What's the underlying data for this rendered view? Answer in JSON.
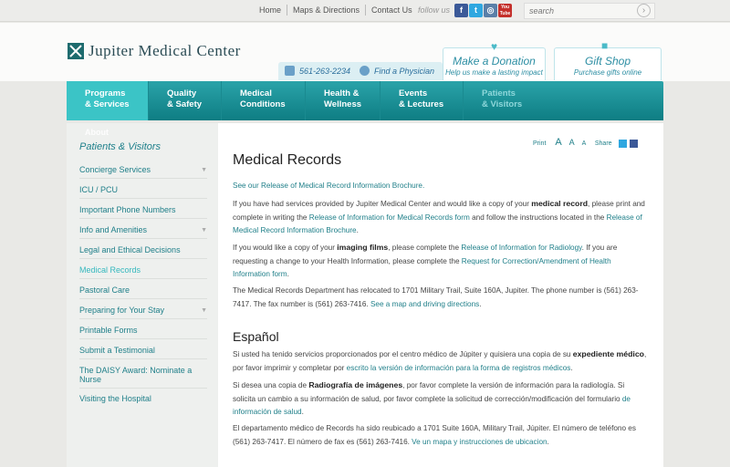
{
  "topbar": {
    "links": [
      "Home",
      "Maps & Directions",
      "Contact Us"
    ],
    "follow_label": "follow us",
    "social": [
      {
        "name": "facebook-icon",
        "glyph": "f",
        "color": "#3b5998"
      },
      {
        "name": "twitter-icon",
        "glyph": "t",
        "color": "#2fa7e0"
      },
      {
        "name": "instagram-icon",
        "glyph": "◎",
        "color": "#5a7fa8"
      },
      {
        "name": "youtube-icon",
        "glyph": "You Tube",
        "color": "#c4302b"
      }
    ],
    "search_placeholder": "search"
  },
  "brand": {
    "name": "Jupiter Medical Center",
    "accent": "#138a91"
  },
  "contact": {
    "phone": "561-263-2234",
    "find_physician": "Find a Physician"
  },
  "promos": [
    {
      "title": "Make a Donation",
      "subtitle": "Help us make a lasting impact"
    },
    {
      "title": "Gift Shop",
      "subtitle": "Purchase gifts online"
    }
  ],
  "nav": [
    {
      "line1": "Programs",
      "line2": "& Services"
    },
    {
      "line1": "Quality",
      "line2": "& Safety"
    },
    {
      "line1": "Medical",
      "line2": "Conditions"
    },
    {
      "line1": "Health &",
      "line2": "Wellness"
    },
    {
      "line1": "Events",
      "line2": "& Lectures"
    },
    {
      "line1": "Patients",
      "line2": "& Visitors"
    }
  ],
  "sidebar": {
    "ghost": "About",
    "heading": "Patients & Visitors",
    "items": [
      {
        "label": "Concierge Services",
        "expand": true
      },
      {
        "label": "ICU / PCU"
      },
      {
        "label": "Important Phone Numbers"
      },
      {
        "label": "Info and Amenities",
        "expand": true
      },
      {
        "label": "Legal and Ethical Decisions"
      },
      {
        "label": "Medical Records",
        "selected": true
      },
      {
        "label": "Pastoral Care"
      },
      {
        "label": "Preparing for Your Stay",
        "expand": true
      },
      {
        "label": "Printable Forms"
      },
      {
        "label": "Submit a Testimonial"
      },
      {
        "label": "The DAISY Award: Nominate a Nurse"
      },
      {
        "label": "Visiting the Hospital"
      }
    ]
  },
  "tools": {
    "print": "Print",
    "font_a1": "A",
    "font_a2": "A",
    "font_a3": "A",
    "share": "Share"
  },
  "content": {
    "title": "Medical Records",
    "p1_link": "See our Release of Medical Record Information Brochure.",
    "p2_a": "If you have had services provided by Jupiter Medical Center and would like a copy of your ",
    "p2_b": "medical record",
    "p2_c": ", please print and complete in writing the ",
    "p2_link1": "Release of Information for Medical Records form",
    "p2_d": " and follow the instructions located in the ",
    "p2_link2": "Release of Medical Record Information Brochure",
    "p2_e": ".",
    "p3_a": "If you would like a copy of your ",
    "p3_b": "imaging films",
    "p3_c": ", please complete the ",
    "p3_link1": "Release of Information for Radiology",
    "p3_d": ". If you are requesting a change to your Health Information, please complete the ",
    "p3_link2": "Request for Correction/Amendment of Health Information form",
    "p3_e": ".",
    "p4_a": "The Medical Records Department has relocated to 1701 Military Trail, Suite 160A, Jupiter. The phone number is (561) 263-7417. The fax number is (561) 263-7416. ",
    "p4_link": "See a map and driving directions",
    "p4_e": ".",
    "spanish_title": "Español",
    "s1_a": "Si usted ha tenido servicios proporcionados por el centro médico de Júpiter y quisiera una copia de su ",
    "s1_b": "expediente médico",
    "s1_c": ", por favor imprimir y completar por ",
    "s1_link": "escrito la versión de información para la forma de registros médicos",
    "s1_d": ".",
    "s2_a": "Si desea una copia de ",
    "s2_b": "Radiografía de imágenes",
    "s2_c": ", por favor complete la versión de información para la radiología. Si solicita un cambio a su información de salud, por favor complete la solicitud de corrección/modificación del formulario ",
    "s2_link": "de información de salud",
    "s2_d": ".",
    "s3_a": "El departamento médico de Records ha sido reubicado a 1701 Suite 160A, Military Trail, Júpiter. El número de teléfono es (561) 263-7417. El número de fax es (561) 263-7416. ",
    "s3_link": "Ve un mapa y instrucciones de ubicacion",
    "s3_d": "."
  }
}
